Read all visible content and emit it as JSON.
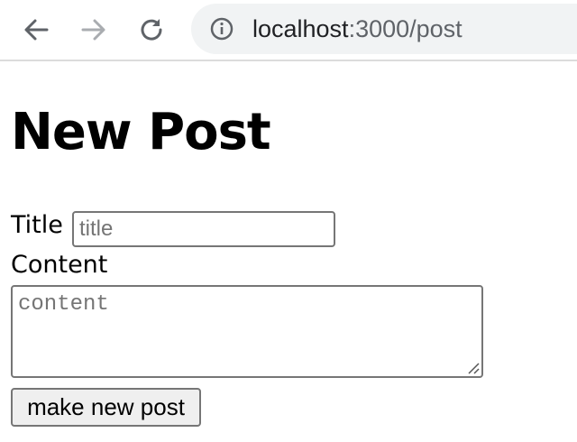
{
  "browser": {
    "url_host": "localhost",
    "url_path": ":3000/post",
    "icons": {
      "back": "back-arrow-icon",
      "forward": "forward-arrow-icon",
      "reload": "reload-icon",
      "site_info": "info-icon"
    }
  },
  "page": {
    "heading": "New Post",
    "form": {
      "title_label": "Title",
      "title_placeholder": "title",
      "title_value": "",
      "content_label": "Content",
      "content_placeholder": "content",
      "content_value": "",
      "submit_label": "make new post"
    }
  }
}
